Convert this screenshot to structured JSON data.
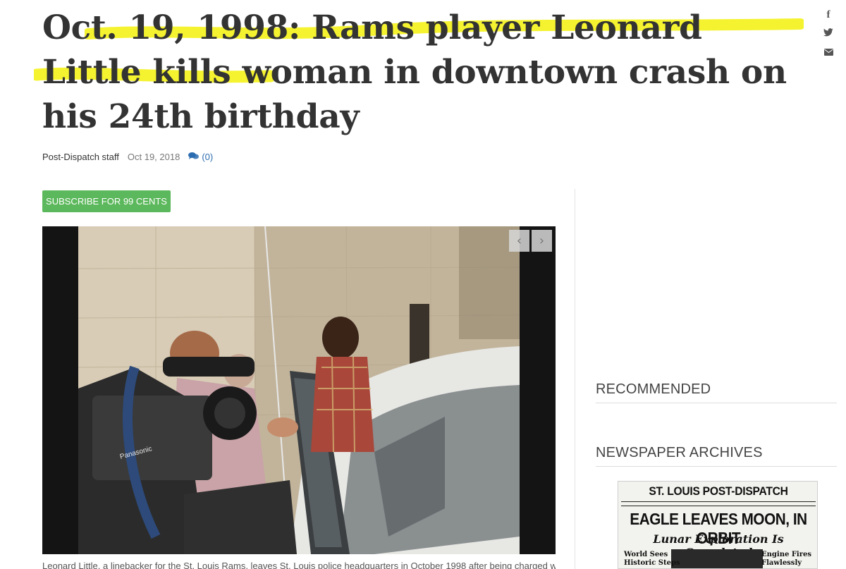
{
  "article": {
    "headline": "Oct. 19, 1998: Rams player Leonard Little kills woman in downtown crash on his 24th birthday",
    "byline": {
      "author": "Post-Dispatch staff",
      "date": "Oct 19, 2018",
      "comments": "(0)"
    },
    "subscribe_label": "SUBSCRIBE FOR 99 CENTS",
    "photo_caption": "Leonard Little, a linebacker for the St. Louis Rams, leaves St. Louis police headquarters in October 1998 after being charged with"
  },
  "photo_camera_brand": "Panasonic",
  "share": {
    "icons": [
      "facebook-icon",
      "twitter-icon",
      "email-icon"
    ]
  },
  "sidebar": {
    "recommended_title": "RECOMMENDED",
    "archives_title": "NEWSPAPER ARCHIVES",
    "archive_page": {
      "masthead": "ST. LOUIS POST-DISPATCH",
      "banner": "EAGLE LEAVES MOON, IN ORBIT",
      "subhead": "Lunar Exploration Is Completed",
      "left_story": "World Sees\nHistoric Steps",
      "right_story": "Engine Fires\nFlawlessly"
    }
  },
  "colors": {
    "highlight": "#f4f21a",
    "subscribe": "#5cb85c",
    "link": "#2b6cb0"
  }
}
